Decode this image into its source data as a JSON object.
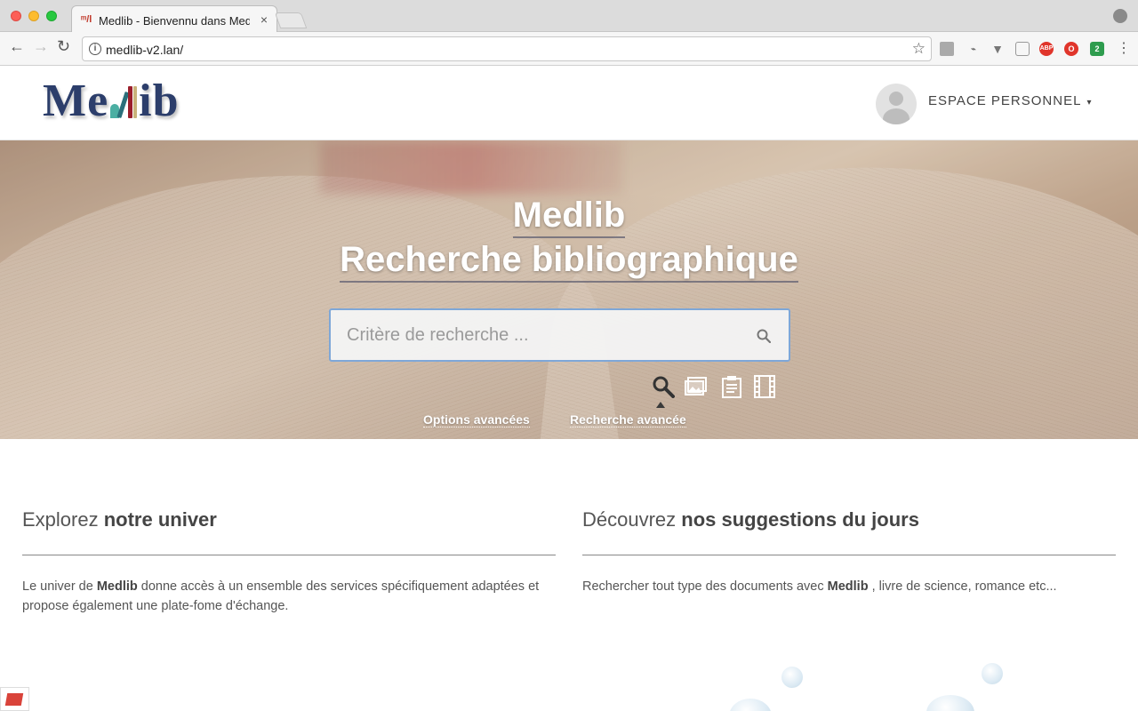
{
  "browser": {
    "tab_title": "Medlib - Bienvennu dans Medlib",
    "tab_favicon": "ᵐ/l",
    "url": "medlib-v2.lan/",
    "extensions": [
      "image-extension-icon",
      "link-extension-icon",
      "vuejs-extension-icon",
      "cube-extension-icon",
      "adblock-plus-icon",
      "opera-icon",
      "badge-extension-icon"
    ],
    "abp_label": "ABP",
    "badge_count": "2"
  },
  "header": {
    "logo": {
      "pre": "Me",
      "post": "ib"
    },
    "user_menu_label": "ESPACE PERSONNEL",
    "user_menu_caret": "▾"
  },
  "hero": {
    "title_line1": "Medlib",
    "title_line2": "Recherche bibliographique",
    "search_placeholder": "Critère de recherche ...",
    "type_icons": [
      "search-type-icon",
      "image-type-icon",
      "document-type-icon",
      "film-type-icon"
    ],
    "selected_type": "search",
    "link_options": "Options avancées",
    "link_advanced": "Recherche avancée"
  },
  "sections": {
    "left": {
      "title_prefix": "Explorez",
      "title_bold": "notre univer",
      "body_pre": "Le univer de",
      "body_bold": "Medlib",
      "body_post": "donne accès à un ensemble des services spécifiquement adaptées et propose également une plate-fome d'échange."
    },
    "right": {
      "title_prefix": "Découvrez",
      "title_bold": "nos suggestions du jours",
      "body_pre": "Rechercher tout type des documents avec",
      "body_bold": "Medlib",
      "body_post": ", livre de science, romance etc..."
    }
  },
  "colors": {
    "logo": "#2c3e6b",
    "search_border": "#7ea7d8",
    "text": "#555555"
  }
}
